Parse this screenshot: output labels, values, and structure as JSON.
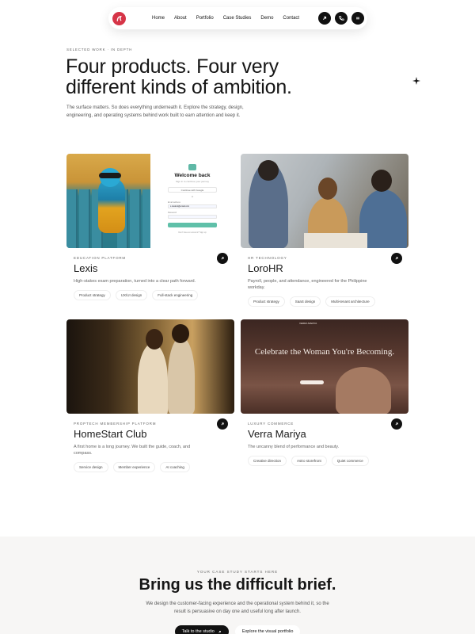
{
  "nav": {
    "links": [
      "Home",
      "About",
      "Portfolio",
      "Case Studies",
      "Demo",
      "Contact"
    ],
    "icons": [
      "arrow-up-right-icon",
      "phone-icon",
      "menu-icon"
    ]
  },
  "hero": {
    "eyebrow": "SELECTED WORK · IN DEPTH",
    "title": "Four products. Four very different kinds of ambition.",
    "subtitle": "The surface matters. So does everything underneath it. Explore the strategy, design, engineering, and operating systems behind work built to earn attention and keep it."
  },
  "cards": [
    {
      "category": "EDUCATION PLATFORM",
      "title": "Lexis",
      "description": "High-stakes exam preparation, turned into a clear path forward.",
      "tags": [
        "Product strategy",
        "UX/UI design",
        "Full-stack engineering"
      ],
      "form": {
        "title": "Welcome back",
        "subtitle": "Sign in to continue your journey",
        "google": "Continue with Google",
        "or": "or",
        "email_label": "Email address",
        "email_value": "s.student@email.com",
        "password_label": "Password",
        "footer": "Don't have an account? Sign up"
      }
    },
    {
      "category": "HR TECHNOLOGY",
      "title": "LoroHR",
      "description": "Payroll, people, and attendance, engineered for the Philippine workday.",
      "tags": [
        "Product strategy",
        "SaaS design",
        "Multi-tenant architecture"
      ]
    },
    {
      "category": "PROPTECH MEMBERSHIP PLATFORM",
      "title": "HomeStart Club",
      "description": "A first home is a long journey. We built the guide, coach, and compass.",
      "tags": [
        "Service design",
        "Member experience",
        "AI coaching"
      ]
    },
    {
      "category": "LUXURY COMMERCE",
      "title": "Verra Mariya",
      "description": "The uncanny blend of performance and beauty.",
      "tags": [
        "Creative direction",
        "Astro storefront",
        "Quiet commerce"
      ],
      "hero_text": "Celebrate the Woman You're Becoming.",
      "brand": "VERRA MARIYA"
    }
  ],
  "cta": {
    "eyebrow": "YOUR CASE STUDY STARTS HERE",
    "title": "Bring us the difficult brief.",
    "subtitle": "We design the customer-facing experience and the operational system behind it, so the result is persuasive on day one and useful long after launch.",
    "primary": "Talk to the studio",
    "secondary": "Explore the visual portfolio"
  },
  "colors": {
    "accent": "#d63447",
    "dark": "#111111",
    "muted": "#666666"
  }
}
